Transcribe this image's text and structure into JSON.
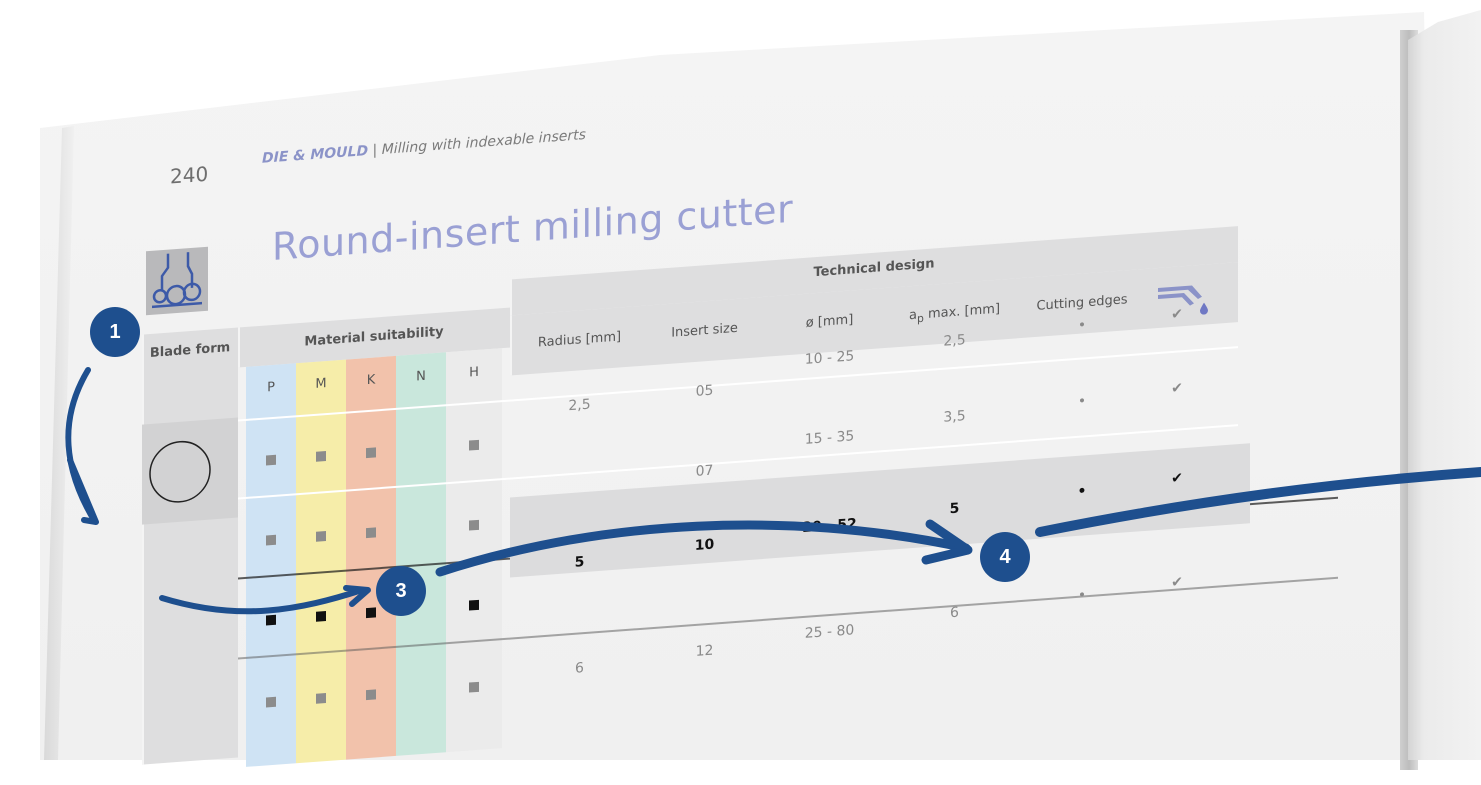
{
  "page_number": "240",
  "running_head": {
    "section": "DIE & MOULD",
    "separator": "|",
    "topic": "Milling with indexable inserts"
  },
  "title": "Round-insert milling cutter",
  "table": {
    "blade_form_label": "Blade form",
    "material_suitability_label": "Material suitability",
    "technical_design_label": "Technical design",
    "materials": [
      {
        "code": "P",
        "color": "#cfe3f4"
      },
      {
        "code": "M",
        "color": "#f6eda9"
      },
      {
        "code": "K",
        "color": "#f2c2ab"
      },
      {
        "code": "N",
        "color": "#c9e7dc"
      },
      {
        "code": "H",
        "color": "#ebebeb"
      }
    ],
    "columns": [
      "Radius [mm]",
      "Insert size",
      "ø [mm]",
      "max. [mm]",
      "Cutting edges"
    ],
    "ap_symbol": "a",
    "ap_subscript": "p",
    "coolant_icon": "coolant-icon",
    "rows": [
      {
        "radius": "",
        "insert": "",
        "diameter": "10 - 25",
        "ap": "2,5",
        "edges": "•",
        "coolant": "✔",
        "highlight": false
      },
      {
        "radius": "2,5",
        "insert": "05",
        "diameter": "",
        "ap": "",
        "edges": "",
        "coolant": "",
        "highlight": false
      },
      {
        "radius": "",
        "insert": "07",
        "diameter": "15 - 35",
        "ap": "3,5",
        "edges": "•",
        "coolant": "✔",
        "highlight": false
      },
      {
        "radius": "5",
        "insert": "10",
        "diameter": "20 - 52",
        "ap": "5",
        "edges": "•",
        "coolant": "✔",
        "highlight": true
      },
      {
        "radius": "6",
        "insert": "12",
        "diameter": "25 - 80",
        "ap": "6",
        "edges": "•",
        "coolant": "✔",
        "highlight": false
      }
    ]
  },
  "callouts": [
    {
      "label": "1"
    },
    {
      "label": "3"
    },
    {
      "label": "4"
    }
  ],
  "colors": {
    "accent": "#1e4f8e",
    "title": "#9aa0d4"
  }
}
